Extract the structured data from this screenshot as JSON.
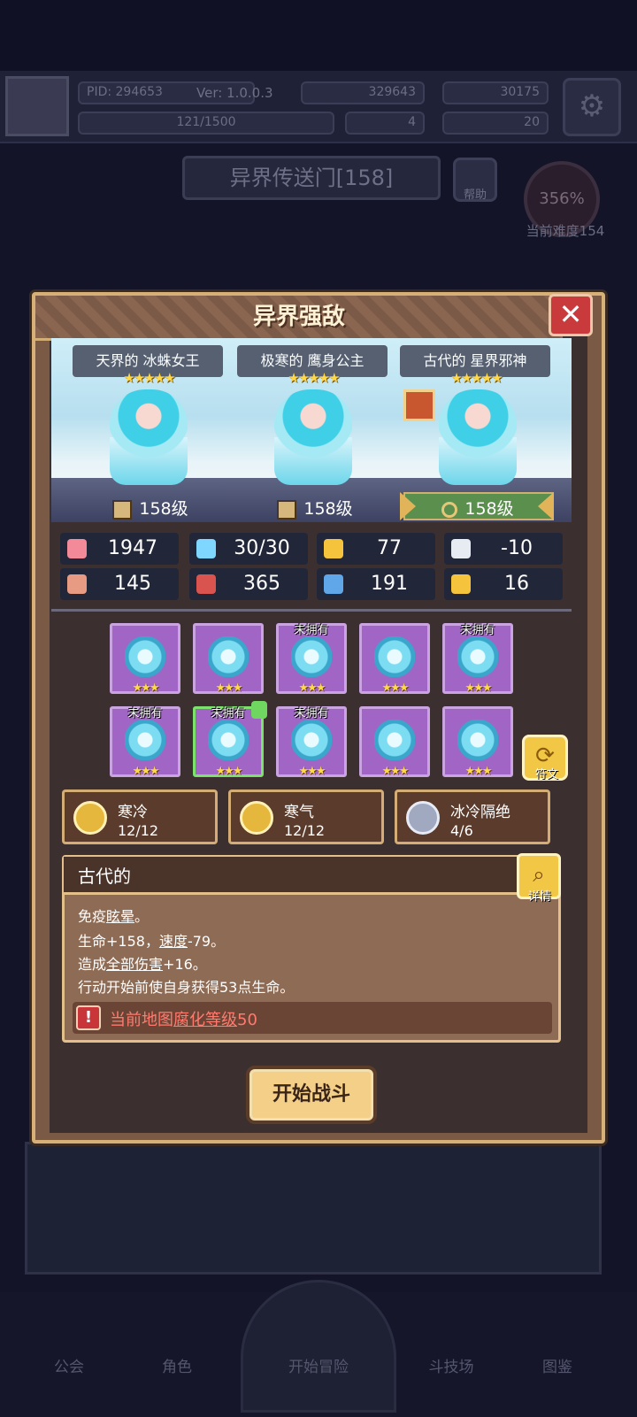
{
  "background": {
    "player_id": "PID: 294653",
    "version": "Ver: 1.0.0.3",
    "gold": "329643",
    "gems": "30175",
    "exp": "121/1500",
    "item_a": "4",
    "item_b": "20",
    "portal_title": "异界传送门[158]",
    "help_label": "帮助",
    "difficulty_pct": "356%",
    "difficulty_label": "当前难度154",
    "nav": [
      "公会",
      "角色",
      "开始冒险",
      "斗技场",
      "图鉴"
    ]
  },
  "modal": {
    "title": "异界强敌",
    "close_label": "✕",
    "enemies": [
      {
        "name": "天界的 冰蛛女王",
        "stars": "★★★★★",
        "level": "158级"
      },
      {
        "name": "极寒的 鹰身公主",
        "stars": "★★★★★",
        "level": "158级"
      },
      {
        "name": "古代的 星界邪神",
        "stars": "★★★★★",
        "level": "158级"
      }
    ],
    "stats": [
      {
        "icon": "heart-icon",
        "value": "1947",
        "color": "#f28a9a"
      },
      {
        "icon": "mana-drop-icon",
        "value": "30/30",
        "color": "#7fd6ff"
      },
      {
        "icon": "shield-icon",
        "value": "77",
        "color": "#f5c43c"
      },
      {
        "icon": "wing-icon",
        "value": "-10",
        "color": "#e6ecf2"
      },
      {
        "icon": "fist-icon",
        "value": "145",
        "color": "#e79b83"
      },
      {
        "icon": "book-icon",
        "value": "365",
        "color": "#d9534f"
      },
      {
        "icon": "scroll-icon",
        "value": "191",
        "color": "#5fa7e8"
      },
      {
        "icon": "horseshoe-icon",
        "value": "16",
        "color": "#f5c43c"
      }
    ],
    "equipment_row1": [
      {
        "icon": "ice-staff-icon",
        "stars": "★★★",
        "tag": ""
      },
      {
        "icon": "ice-potion-icon",
        "stars": "★★★",
        "tag": ""
      },
      {
        "icon": "amulet-icon",
        "stars": "★★★",
        "tag": "未拥有"
      },
      {
        "icon": "snowflake-icon",
        "stars": "★★★",
        "tag": ""
      },
      {
        "icon": "ice-ring-icon",
        "stars": "★★★",
        "tag": "未拥有"
      }
    ],
    "equipment_row2": [
      {
        "icon": "ice-hat-icon",
        "stars": "★★★",
        "tag": "未拥有"
      },
      {
        "icon": "ice-robe-icon",
        "stars": "★★★",
        "tag": "未拥有"
      },
      {
        "icon": "ice-crystal-icon",
        "stars": "★★★",
        "tag": "未拥有"
      },
      {
        "icon": "fur-collar-icon",
        "stars": "★★★",
        "tag": ""
      },
      {
        "icon": "boots-icon",
        "stars": "★★★",
        "tag": ""
      }
    ],
    "rune_label": "符文",
    "sets": [
      {
        "name": "寒冷",
        "count": "12/12"
      },
      {
        "name": "寒气",
        "count": "12/12"
      },
      {
        "name": "冰冷隔绝",
        "count": "4/6"
      }
    ],
    "desc": {
      "title": "古代的",
      "detail_label": "详情",
      "line1_a": "免疫",
      "line1_b": "眩晕",
      "line1_c": "。",
      "line2_a": "生命+158，",
      "line2_b": "速度",
      "line2_c": "-79。",
      "line3_a": "造成",
      "line3_b": "全部伤害",
      "line3_c": "+16。",
      "line4": "行动开始前使自身获得53点生命。",
      "warning_a": "当前地图",
      "warning_b": "腐化等级",
      "warning_c": "50"
    },
    "start_button": "开始战斗"
  }
}
